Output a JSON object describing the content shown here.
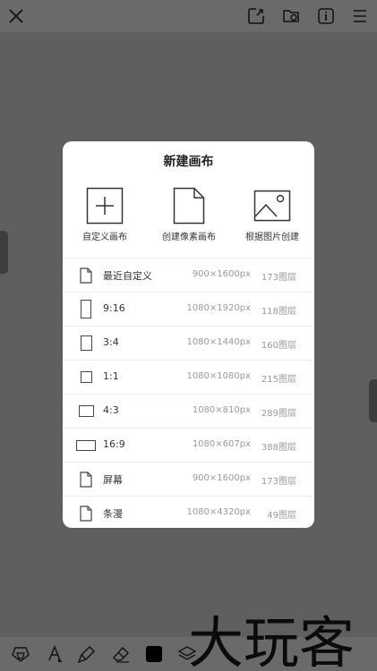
{
  "toolbar": {
    "close_icon": "close-icon",
    "icons": [
      "export-icon",
      "folder-icon",
      "info-icon",
      "more-icon"
    ]
  },
  "dialog": {
    "title": "新建画布",
    "options": [
      {
        "label": "自定义画布",
        "icon": "plus-square-icon"
      },
      {
        "label": "创建像素画布",
        "icon": "blank-file-icon"
      },
      {
        "label": "根据图片创建",
        "icon": "image-icon"
      }
    ],
    "presets": [
      {
        "name": "最近自定义",
        "size": "900×1600px",
        "layers": "173图层",
        "icon": "file-icon"
      },
      {
        "name": "9:16",
        "size": "1080×1920px",
        "layers": "118图层",
        "icon": "ratio-9-16-icon"
      },
      {
        "name": "3:4",
        "size": "1080×1440px",
        "layers": "160图层",
        "icon": "ratio-3-4-icon"
      },
      {
        "name": "1:1",
        "size": "1080×1080px",
        "layers": "215图层",
        "icon": "ratio-1-1-icon"
      },
      {
        "name": "4:3",
        "size": "1080×810px",
        "layers": "289图层",
        "icon": "ratio-4-3-icon"
      },
      {
        "name": "16:9",
        "size": "1080×607px",
        "layers": "388图层",
        "icon": "ratio-16-9-icon"
      },
      {
        "name": "屏幕",
        "size": "900×1600px",
        "layers": "173图层",
        "icon": "file-icon"
      },
      {
        "name": "条漫",
        "size": "1080×4320px",
        "layers": "49图层",
        "icon": "file-icon"
      }
    ]
  },
  "bottombar": {
    "icons": [
      "shapes-icon",
      "fill-icon",
      "brush-icon",
      "eraser-icon",
      "color-swatch-icon",
      "layers-icon"
    ]
  },
  "watermark": {
    "text": "大玩客"
  },
  "colors": {
    "background": "#5f5f5f",
    "dialog": "#ffffff",
    "handle": "#3d3d3d"
  }
}
